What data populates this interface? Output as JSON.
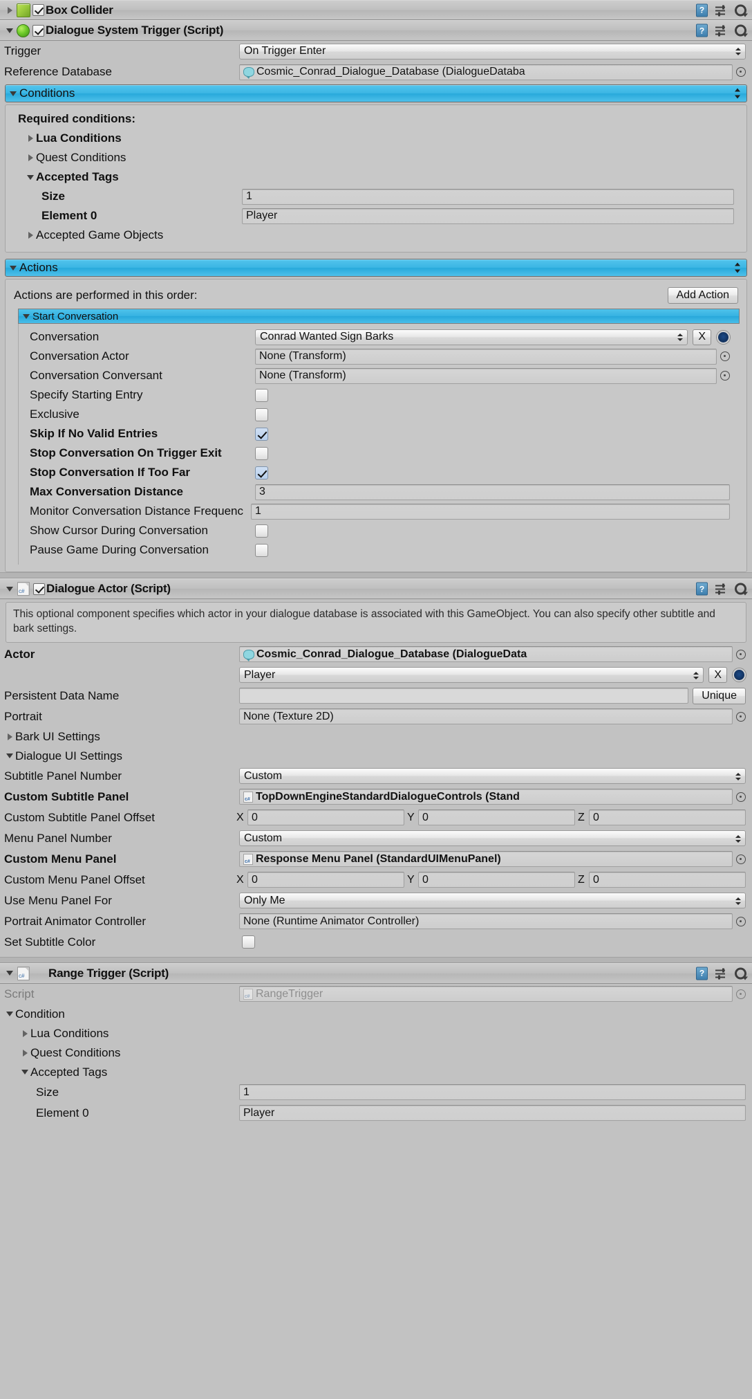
{
  "components": {
    "box_collider": {
      "title": "Box Collider",
      "enabled": true
    },
    "dialogue_system_trigger": {
      "title": "Dialogue System Trigger (Script)",
      "enabled": true,
      "trigger_label": "Trigger",
      "trigger_value": "On Trigger Enter",
      "reference_database_label": "Reference Database",
      "reference_database_value": "Cosmic_Conrad_Dialogue_Database (DialogueDataba",
      "conditions": {
        "header": "Conditions",
        "required_label": "Required conditions:",
        "lua_conditions": "Lua Conditions",
        "quest_conditions": "Quest Conditions",
        "accepted_tags": "Accepted Tags",
        "size_label": "Size",
        "size_value": "1",
        "element0_label": "Element 0",
        "element0_value": "Player",
        "accepted_game_objects": "Accepted Game Objects"
      },
      "actions": {
        "header": "Actions",
        "order_note": "Actions are performed in this order:",
        "add_action_button": "Add Action",
        "start_conversation": {
          "header": "Start Conversation",
          "conversation_label": "Conversation",
          "conversation_value": "Conrad Wanted Sign Barks",
          "clear_button": "X",
          "conversation_actor_label": "Conversation Actor",
          "conversation_actor_value": "None (Transform)",
          "conversation_conversant_label": "Conversation Conversant",
          "conversation_conversant_value": "None (Transform)",
          "specify_starting_entry_label": "Specify Starting Entry",
          "specify_starting_entry_checked": false,
          "exclusive_label": "Exclusive",
          "exclusive_checked": false,
          "skip_if_no_valid_entries_label": "Skip If No Valid Entries",
          "skip_if_no_valid_entries_checked": true,
          "stop_conversation_on_trigger_exit_label": "Stop Conversation On Trigger Exit",
          "stop_conversation_on_trigger_exit_checked": false,
          "stop_conversation_if_too_far_label": "Stop Conversation If Too Far",
          "stop_conversation_if_too_far_checked": true,
          "max_conversation_distance_label": "Max Conversation Distance",
          "max_conversation_distance_value": "3",
          "monitor_distance_frequency_label": "Monitor Conversation Distance Frequenc",
          "monitor_distance_frequency_value": "1",
          "show_cursor_label": "Show Cursor During Conversation",
          "show_cursor_checked": false,
          "pause_game_label": "Pause Game During Conversation",
          "pause_game_checked": false
        }
      }
    },
    "dialogue_actor": {
      "title": "Dialogue Actor (Script)",
      "enabled": true,
      "help_text": "This optional component specifies which actor in your dialogue database is associated with this GameObject. You can also specify other subtitle and bark settings.",
      "actor_label": "Actor",
      "actor_value": "Cosmic_Conrad_Dialogue_Database (DialogueData",
      "actor_dropdown_value": "Player",
      "actor_clear_button": "X",
      "persistent_data_name_label": "Persistent Data Name",
      "persistent_data_name_value": "",
      "unique_button": "Unique",
      "portrait_label": "Portrait",
      "portrait_value": "None (Texture 2D)",
      "bark_ui_settings": "Bark UI Settings",
      "dialogue_ui_settings": "Dialogue UI Settings",
      "subtitle_panel_number_label": "Subtitle Panel Number",
      "subtitle_panel_number_value": "Custom",
      "custom_subtitle_panel_label": "Custom Subtitle Panel",
      "custom_subtitle_panel_value": "TopDownEngineStandardDialogueControls (Stand",
      "custom_subtitle_panel_offset_label": "Custom Subtitle Panel Offset",
      "custom_subtitle_panel_offset": {
        "x": "0",
        "y": "0",
        "z": "0"
      },
      "menu_panel_number_label": "Menu Panel Number",
      "menu_panel_number_value": "Custom",
      "custom_menu_panel_label": "Custom Menu Panel",
      "custom_menu_panel_value": "Response Menu Panel (StandardUIMenuPanel)",
      "custom_menu_panel_offset_label": "Custom Menu Panel Offset",
      "custom_menu_panel_offset": {
        "x": "0",
        "y": "0",
        "z": "0"
      },
      "use_menu_panel_for_label": "Use Menu Panel For",
      "use_menu_panel_for_value": "Only Me",
      "portrait_animator_controller_label": "Portrait Animator Controller",
      "portrait_animator_controller_value": "None (Runtime Animator Controller)",
      "set_subtitle_color_label": "Set Subtitle Color",
      "set_subtitle_color_checked": false,
      "axis_x": "X",
      "axis_y": "Y",
      "axis_z": "Z"
    },
    "range_trigger": {
      "title": "Range Trigger (Script)",
      "script_label": "Script",
      "script_value": "RangeTrigger",
      "condition_label": "Condition",
      "lua_conditions": "Lua Conditions",
      "quest_conditions": "Quest Conditions",
      "accepted_tags": "Accepted Tags",
      "size_label": "Size",
      "size_value": "1",
      "element0_label": "Element 0",
      "element0_value": "Player"
    }
  },
  "icons": {
    "help": "?",
    "cs": "c#"
  },
  "colors": {
    "accent_blue": "#35b2e2",
    "panel_bg": "#c2c2c2",
    "field_bg": "#cfcfcf"
  }
}
